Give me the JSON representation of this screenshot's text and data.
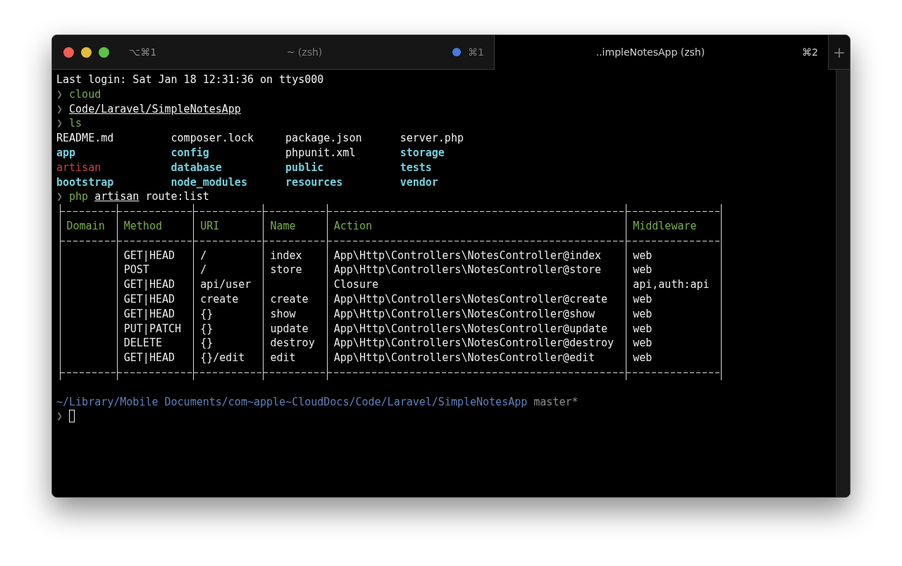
{
  "window": {
    "shortcut": "⌥⌘1"
  },
  "tabs": [
    {
      "title": "~ (zsh)",
      "shortcut": "⌘1",
      "selected": false,
      "activity": true
    },
    {
      "title": "..impleNotesApp (zsh)",
      "shortcut": "⌘2",
      "selected": true,
      "activity": false
    }
  ],
  "new_tab": {
    "label": "+"
  },
  "terminal": {
    "login": "Last login: Sat Jan 18 12:31:36 on ttys000",
    "commands": [
      [
        {
          "kind": "prompt",
          "text": "❯"
        },
        {
          "kind": "command",
          "text": "cloud"
        }
      ],
      [
        {
          "kind": "prompt",
          "text": "❯"
        },
        {
          "kind": "path",
          "text": "Code/Laravel/SimpleNotesApp"
        }
      ],
      [
        {
          "kind": "prompt",
          "text": "❯"
        },
        {
          "kind": "command",
          "text": "ls"
        }
      ]
    ],
    "listing": [
      {
        "name": "README.md",
        "kind": "file"
      },
      {
        "name": "composer.lock",
        "kind": "file"
      },
      {
        "name": "package.json",
        "kind": "file"
      },
      {
        "name": "server.php",
        "kind": "file"
      },
      {
        "name": "app",
        "kind": "dir"
      },
      {
        "name": "config",
        "kind": "dir"
      },
      {
        "name": "phpunit.xml",
        "kind": "file"
      },
      {
        "name": "storage",
        "kind": "dir"
      },
      {
        "name": "artisan",
        "kind": "exec"
      },
      {
        "name": "database",
        "kind": "dir"
      },
      {
        "name": "public",
        "kind": "dir"
      },
      {
        "name": "tests",
        "kind": "dir"
      },
      {
        "name": "bootstrap",
        "kind": "dir"
      },
      {
        "name": "node_modules",
        "kind": "dir"
      },
      {
        "name": "resources",
        "kind": "dir"
      },
      {
        "name": "vendor",
        "kind": "dir"
      }
    ],
    "route_command": [
      {
        "kind": "prompt",
        "text": "❯"
      },
      {
        "kind": "command",
        "text": "php"
      },
      {
        "kind": "path",
        "text": "artisan"
      },
      {
        "kind": "plain",
        "text": "route:list"
      }
    ],
    "table": {
      "columns": [
        "Domain",
        "Method",
        "URI",
        "Name",
        "Action",
        "Middleware"
      ],
      "rows": [
        {
          "method": "GET|HEAD",
          "uri": "/",
          "name": "index",
          "action": "App\\Http\\Controllers\\NotesController@index",
          "middleware": "web"
        },
        {
          "method": "POST",
          "uri": "/",
          "name": "store",
          "action": "App\\Http\\Controllers\\NotesController@store",
          "middleware": "web"
        },
        {
          "method": "GET|HEAD",
          "uri": "api/user",
          "action": "Closure",
          "middleware": "api,auth:api"
        },
        {
          "method": "GET|HEAD",
          "uri": "create",
          "name": "create",
          "action": "App\\Http\\Controllers\\NotesController@create",
          "middleware": "web"
        },
        {
          "method": "GET|HEAD",
          "uri": "{}",
          "name": "show",
          "action": "App\\Http\\Controllers\\NotesController@show",
          "middleware": "web"
        },
        {
          "method": "PUT|PATCH",
          "uri": "{}",
          "name": "update",
          "action": "App\\Http\\Controllers\\NotesController@update",
          "middleware": "web"
        },
        {
          "method": "DELETE",
          "uri": "{}",
          "name": "destroy",
          "action": "App\\Http\\Controllers\\NotesController@destroy",
          "middleware": "web"
        },
        {
          "method": "GET|HEAD",
          "uri": "{}/edit",
          "name": "edit",
          "action": "App\\Http\\Controllers\\NotesController@edit",
          "middleware": "web"
        }
      ]
    },
    "cwd": "~/Library/Mobile Documents/com~apple~CloudDocs/Code/Laravel/SimpleNotesApp",
    "branch": "master*",
    "prompt": "❯"
  }
}
